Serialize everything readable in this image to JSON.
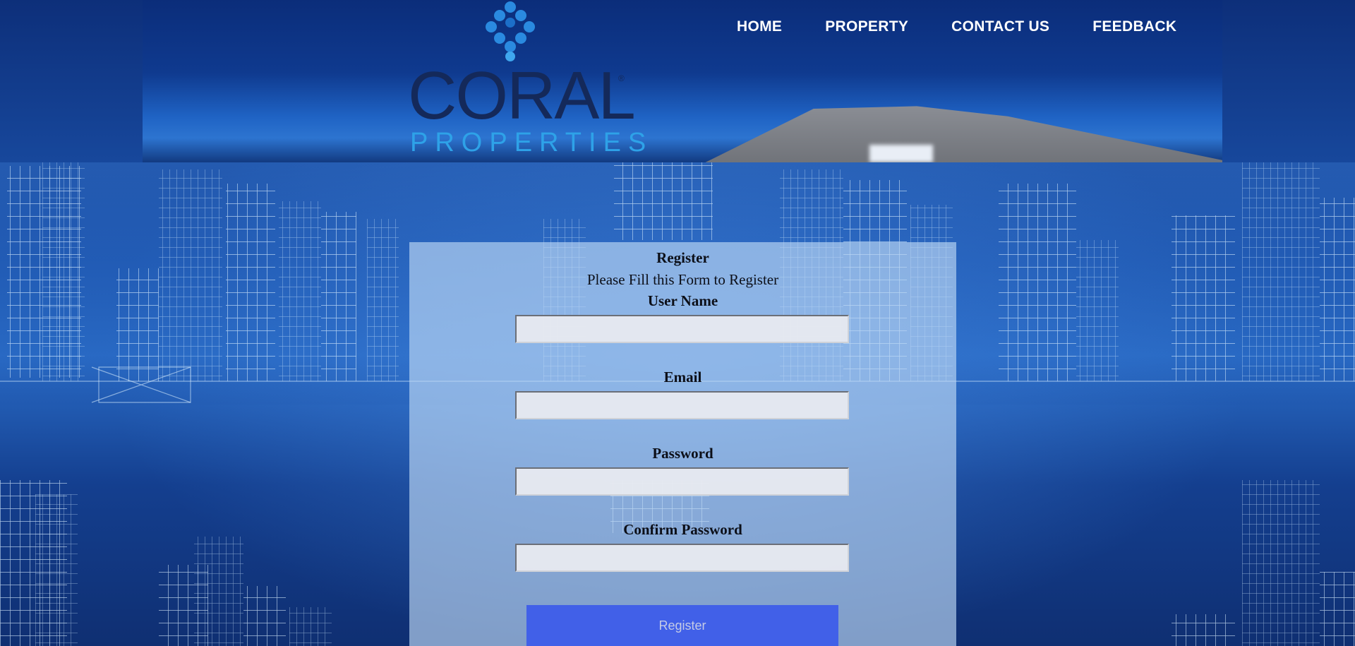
{
  "brand": {
    "name": "CORAL",
    "tagline": "PROPERTIES",
    "trademark": "®"
  },
  "nav": {
    "items": [
      {
        "label": "HOME"
      },
      {
        "label": "PROPERTY"
      },
      {
        "label": "CONTACT US"
      },
      {
        "label": "FEEDBACK"
      }
    ]
  },
  "form": {
    "title": "Register",
    "subtitle": "Please Fill this Form to Register",
    "fields": [
      {
        "label": "User Name",
        "value": "",
        "placeholder": ""
      },
      {
        "label": "Email",
        "value": "",
        "placeholder": ""
      },
      {
        "label": "Password",
        "value": "",
        "placeholder": ""
      },
      {
        "label": "Confirm Password",
        "value": "",
        "placeholder": ""
      }
    ],
    "submit_label": "Register"
  },
  "colors": {
    "header_bg": "#0f3a8f",
    "logo_word": "#14295a",
    "logo_accent": "#2ea2e8",
    "panel_bg": "#bcd7f5",
    "button_bg": "#4160e8",
    "button_text": "#c5cbe6"
  },
  "icons": {
    "logo_mark": "coral-dots-icon"
  }
}
